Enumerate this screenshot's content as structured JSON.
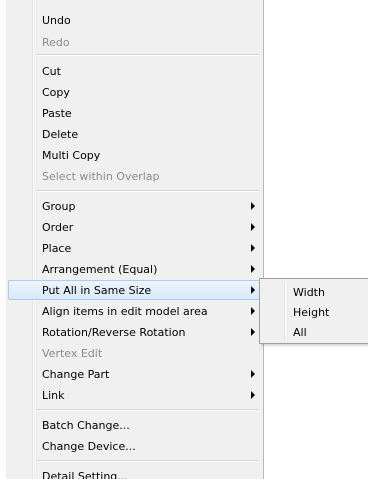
{
  "context_menu": {
    "items": [
      {
        "label": "Undo"
      },
      {
        "label": "Redo"
      },
      {
        "label": "Cut"
      },
      {
        "label": "Copy"
      },
      {
        "label": "Paste"
      },
      {
        "label": "Delete"
      },
      {
        "label": "Multi Copy"
      },
      {
        "label": "Select within Overlap"
      },
      {
        "label": "Group"
      },
      {
        "label": "Order"
      },
      {
        "label": "Place"
      },
      {
        "label": "Arrangement (Equal)"
      },
      {
        "label": "Put All in Same Size"
      },
      {
        "label": "Align items in edit model area"
      },
      {
        "label": "Rotation/Reverse Rotation"
      },
      {
        "label": "Vertex Edit"
      },
      {
        "label": "Change Part"
      },
      {
        "label": "Link"
      },
      {
        "label": "Batch Change..."
      },
      {
        "label": "Change Device..."
      },
      {
        "label": "Detail Setting..."
      }
    ]
  },
  "submenu": {
    "items": [
      {
        "label": "Width"
      },
      {
        "label": "Height"
      },
      {
        "label": "All"
      }
    ]
  }
}
